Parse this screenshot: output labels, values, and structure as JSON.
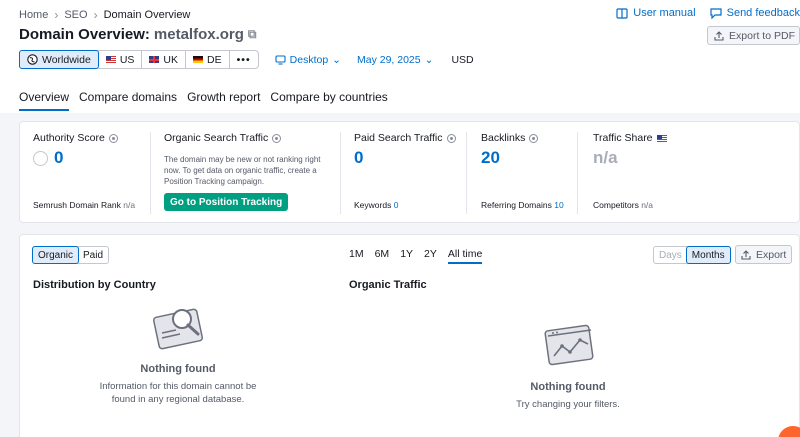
{
  "breadcrumb": [
    "Home",
    "SEO",
    "Domain Overview"
  ],
  "header": {
    "user_manual": "User manual",
    "send_feedback": "Send feedback",
    "title_prefix": "Domain Overview:",
    "domain": "metalfox.org",
    "export_pdf": "Export to PDF"
  },
  "databases": {
    "items": [
      {
        "label": "Worldwide",
        "icon": "globe-icon",
        "active": true
      },
      {
        "label": "US",
        "icon": "us-flag"
      },
      {
        "label": "UK",
        "icon": "uk-flag"
      },
      {
        "label": "DE",
        "icon": "de-flag"
      }
    ],
    "more_icon": "ellipsis-icon",
    "device": "Desktop",
    "date": "May 29, 2025",
    "currency": "USD"
  },
  "tabs": [
    "Overview",
    "Compare domains",
    "Growth report",
    "Compare by countries"
  ],
  "metrics": {
    "authority": {
      "label": "Authority Score",
      "value": "0",
      "footer_label": "Semrush Domain Rank",
      "footer_value": "n/a"
    },
    "organic": {
      "label": "Organic Search Traffic",
      "description": "The domain may be new or not ranking right now. To get data on organic traffic, create a Position Tracking campaign.",
      "button": "Go to Position Tracking"
    },
    "paid": {
      "label": "Paid Search Traffic",
      "value": "0",
      "footer_label": "Keywords",
      "footer_value": "0"
    },
    "backlinks": {
      "label": "Backlinks",
      "value": "20",
      "footer_label": "Referring Domains",
      "footer_value": "10"
    },
    "share": {
      "label": "Traffic Share",
      "value": "n/a",
      "footer_label": "Competitors",
      "footer_value": "n/a"
    }
  },
  "lower": {
    "type_toggle": [
      "Organic",
      "Paid"
    ],
    "ranges": [
      "1M",
      "6M",
      "1Y",
      "2Y",
      "All time"
    ],
    "granularity": [
      "Days",
      "Months"
    ],
    "export": "Export",
    "distribution": {
      "title": "Distribution by Country",
      "empty_title": "Nothing found",
      "empty_line1": "Information for this domain cannot be",
      "empty_line2": "found in any regional database."
    },
    "traffic": {
      "title": "Organic Traffic",
      "empty_title": "Nothing found",
      "empty_sub": "Try changing your filters."
    }
  },
  "colors": {
    "accent": "#006dca",
    "green": "#009f81",
    "orange": "#ff642d"
  }
}
